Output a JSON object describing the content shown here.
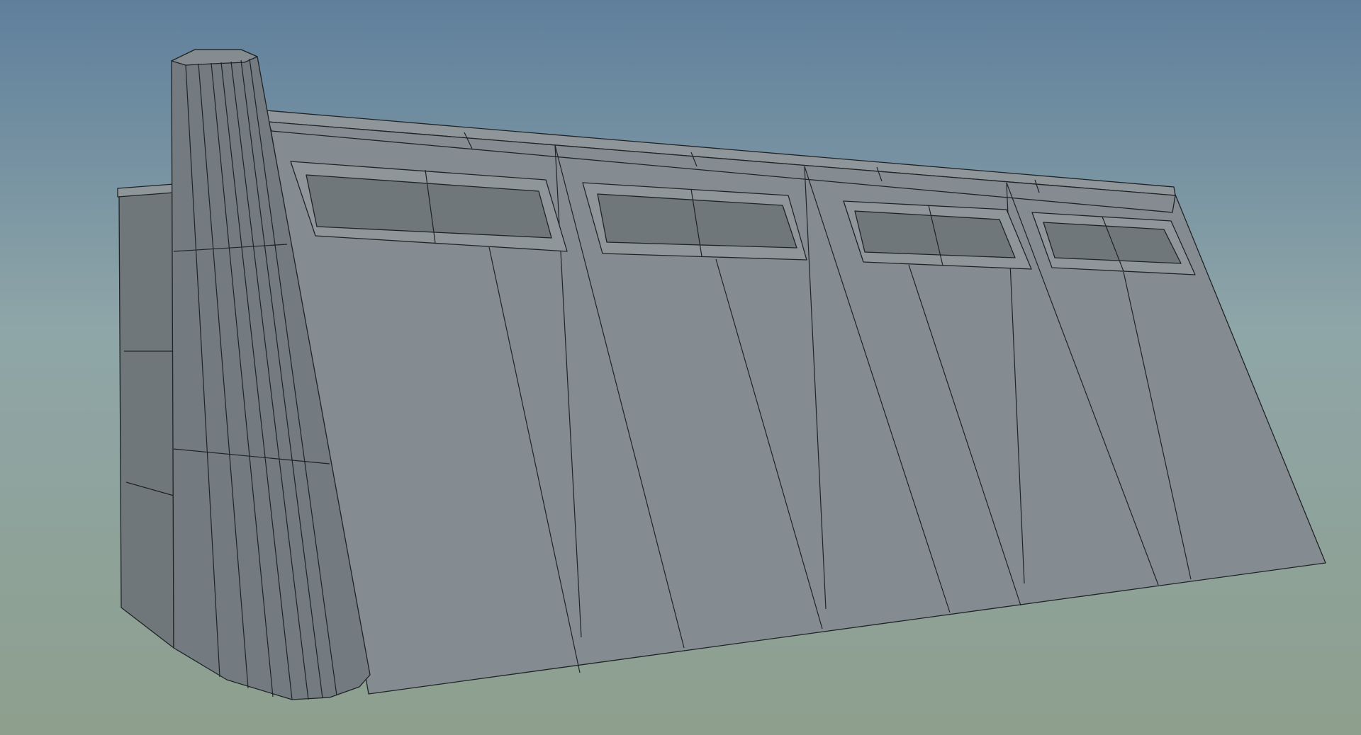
{
  "viewport": {
    "background_top": "#5f7f9c",
    "background_mid": "#8fa6a8",
    "background_bottom": "#8e9f8d"
  },
  "model": {
    "subject": "wireframe-building-facade",
    "wall_color": "#858c91",
    "wall_light": "#8f969a",
    "wall_dark": "#6f777b",
    "pillar_color": "#737b80",
    "pillar_light": "#848c90",
    "edge_color": "#1e2326",
    "window_panes": 2,
    "bays": 4
  }
}
